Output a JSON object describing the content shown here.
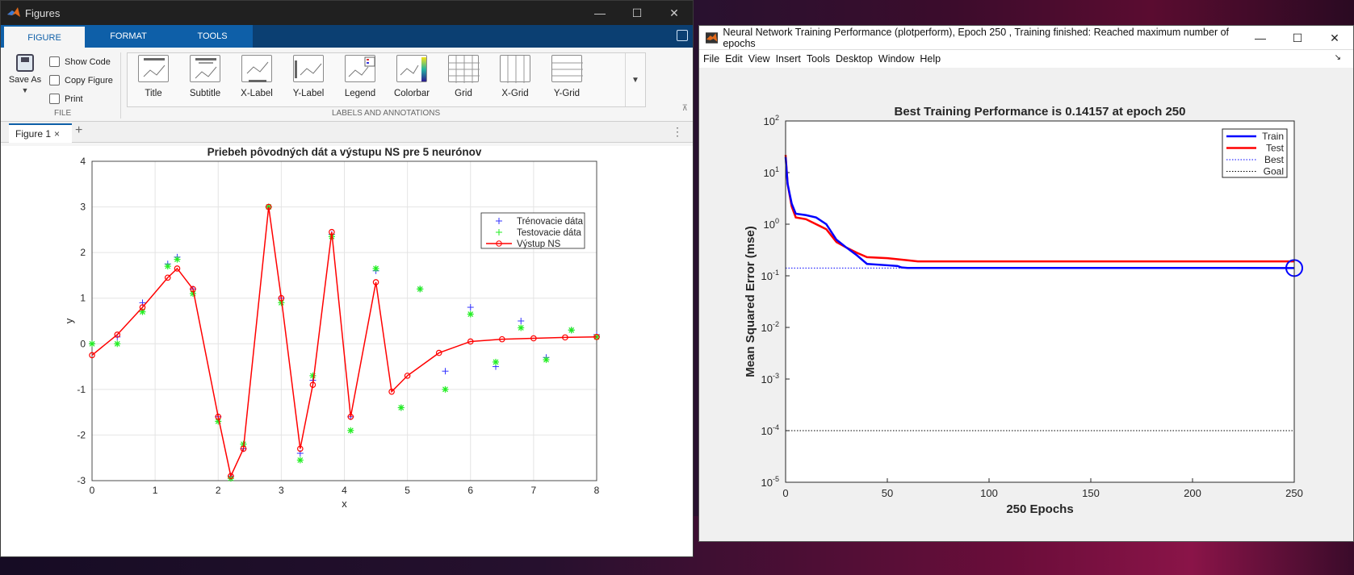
{
  "win1": {
    "title": "Figures",
    "controls": {
      "min": "—",
      "max": "☐",
      "close": "✕"
    },
    "tabs": [
      "FIGURE",
      "FORMAT",
      "TOOLS"
    ],
    "save_as": "Save As",
    "file_items": [
      "Show Code",
      "Copy Figure",
      "Print"
    ],
    "file_group": "FILE",
    "labels_group": "LABELS AND ANNOTATIONS",
    "label_tools": [
      "Title",
      "Subtitle",
      "X-Label",
      "Y-Label",
      "Legend",
      "Colorbar",
      "Grid",
      "X-Grid",
      "Y-Grid"
    ],
    "figure_tab": "Figure 1",
    "figure_tab_close": "×",
    "add_tab": "+",
    "more": "⋮"
  },
  "win2": {
    "title": "Neural Network Training Performance (plotperform), Epoch 250 , Training finished: Reached maximum number of epochs",
    "controls": {
      "min": "—",
      "max": "☐",
      "close": "✕"
    },
    "menu": [
      "File",
      "Edit",
      "View",
      "Insert",
      "Tools",
      "Desktop",
      "Window",
      "Help"
    ],
    "menu_arrow": "↘"
  },
  "chart_data": [
    {
      "type": "line",
      "title": "Priebeh pôvodných dát a výstupu NS pre 5 neurónov",
      "xlabel": "x",
      "ylabel": "y",
      "xlim": [
        0,
        8
      ],
      "ylim": [
        -3,
        4
      ],
      "xticks": [
        "0",
        "1",
        "2",
        "3",
        "4",
        "5",
        "6",
        "7",
        "8"
      ],
      "yticks": [
        "-3",
        "-2",
        "-1",
        "0",
        "1",
        "2",
        "3",
        "4"
      ],
      "grid": true,
      "legend_position": "top-right",
      "series": [
        {
          "name": "Trénovacie dáta",
          "marker": "+",
          "color": "#3333ff",
          "x": [
            0,
            0.4,
            0.8,
            1.2,
            1.35,
            1.6,
            2.0,
            2.2,
            2.4,
            2.8,
            3.0,
            3.3,
            3.5,
            3.8,
            4.1,
            4.5,
            4.9,
            5.2,
            5.6,
            6.0,
            6.4,
            6.8,
            7.2,
            7.6,
            8.0
          ],
          "values": [
            0,
            0.15,
            0.9,
            1.75,
            1.9,
            1.2,
            -1.6,
            -2.9,
            -2.3,
            3.0,
            1.0,
            -2.4,
            -0.8,
            2.4,
            -1.6,
            1.6,
            -1.4,
            1.2,
            -0.6,
            0.8,
            -0.5,
            0.5,
            -0.3,
            0.3,
            0.2
          ]
        },
        {
          "name": "Testovacie dáta",
          "marker": "*",
          "color": "#22ee22",
          "x": [
            0,
            0.4,
            0.8,
            1.2,
            1.35,
            1.6,
            2.0,
            2.2,
            2.4,
            2.8,
            3.0,
            3.3,
            3.5,
            3.8,
            4.1,
            4.5,
            4.9,
            5.2,
            5.6,
            6.0,
            6.4,
            6.8,
            7.2,
            7.6,
            8.0
          ],
          "values": [
            0,
            0.0,
            0.7,
            1.7,
            1.85,
            1.1,
            -1.7,
            -2.95,
            -2.2,
            3.0,
            0.9,
            -2.55,
            -0.7,
            2.35,
            -1.9,
            1.65,
            -1.4,
            1.2,
            -1.0,
            0.65,
            -0.4,
            0.35,
            -0.35,
            0.3,
            0.15
          ]
        },
        {
          "name": "Výstup NS",
          "marker": "o",
          "color": "#ff0000",
          "x": [
            0,
            0.4,
            0.8,
            1.2,
            1.35,
            1.6,
            2.0,
            2.2,
            2.4,
            2.8,
            3.0,
            3.3,
            3.5,
            3.8,
            4.1,
            4.5,
            4.75,
            5.0,
            5.5,
            6.0,
            6.5,
            7.0,
            7.5,
            8.0
          ],
          "values": [
            -0.25,
            0.2,
            0.8,
            1.45,
            1.65,
            1.2,
            -1.6,
            -2.9,
            -2.3,
            3.0,
            1.0,
            -2.3,
            -0.9,
            2.45,
            -1.6,
            1.35,
            -1.05,
            -0.7,
            -0.2,
            0.05,
            0.1,
            0.12,
            0.14,
            0.15
          ]
        }
      ]
    },
    {
      "type": "line",
      "title": "Best Training Performance is 0.14157 at epoch 250",
      "xlabel": "250 Epochs",
      "ylabel": "Mean Squared Error  (mse)",
      "xlim": [
        0,
        250
      ],
      "ylim": [
        1e-05,
        100
      ],
      "yscale": "log",
      "xticks": [
        "0",
        "50",
        "100",
        "150",
        "200",
        "250"
      ],
      "ytick_bases": [
        "10",
        "10",
        "10",
        "10",
        "10",
        "10",
        "10",
        "10"
      ],
      "ytick_exps": [
        "2",
        "1",
        "0",
        "-1",
        "-2",
        "-3",
        "-4",
        "-5"
      ],
      "legend_position": "top-right",
      "series": [
        {
          "name": "Train",
          "color": "#0000ff",
          "x": [
            0,
            1,
            3,
            5,
            10,
            15,
            20,
            25,
            30,
            35,
            40,
            50,
            55,
            57,
            60,
            100,
            150,
            200,
            250
          ],
          "values": [
            20,
            6,
            2.5,
            1.6,
            1.5,
            1.35,
            1.0,
            0.5,
            0.35,
            0.25,
            0.17,
            0.16,
            0.155,
            0.145,
            0.142,
            0.142,
            0.142,
            0.142,
            0.14157
          ]
        },
        {
          "name": "Test",
          "color": "#ff0000",
          "x": [
            0,
            1,
            3,
            5,
            10,
            15,
            20,
            25,
            30,
            35,
            40,
            50,
            60,
            65,
            100,
            150,
            200,
            250
          ],
          "values": [
            22,
            6,
            2.2,
            1.35,
            1.25,
            1.0,
            0.8,
            0.45,
            0.35,
            0.28,
            0.23,
            0.22,
            0.2,
            0.19,
            0.19,
            0.19,
            0.19,
            0.19
          ]
        },
        {
          "name": "Best",
          "color": "#0000ff",
          "style": "dotted",
          "value": 0.14157,
          "epoch": 250
        },
        {
          "name": "Goal",
          "color": "#000000",
          "style": "dotted",
          "value": 0.0001
        }
      ]
    }
  ]
}
